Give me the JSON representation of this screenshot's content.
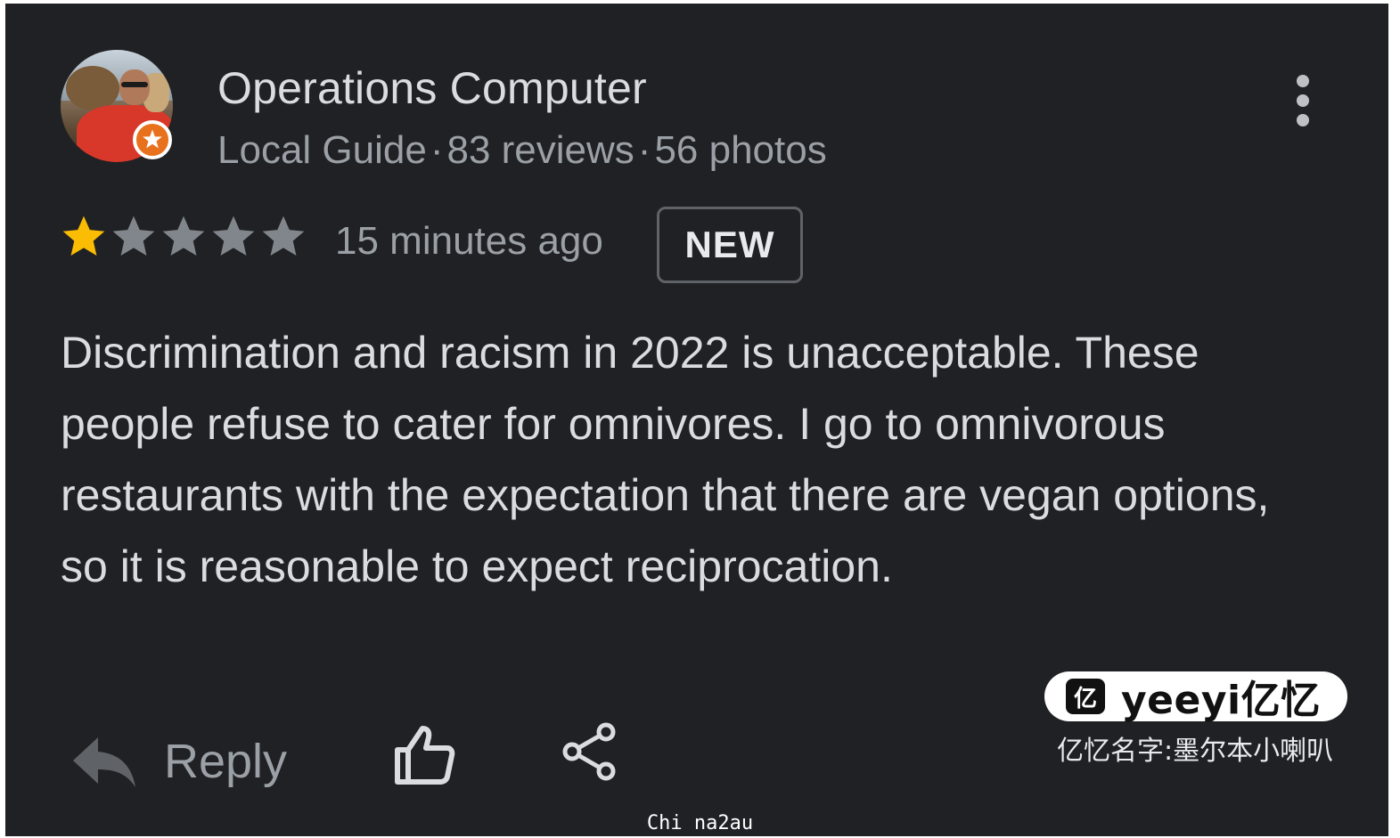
{
  "review": {
    "author": {
      "name": "Operations Computer",
      "role": "Local Guide",
      "separator": "·",
      "reviews": "83 reviews",
      "photos": "56 photos",
      "badge_icon": "local-guide-star-icon",
      "badge_color": "#e8711e"
    },
    "rating": {
      "value": 1,
      "max": 5,
      "filled_color": "#fbbc04",
      "empty_color": "#80868b"
    },
    "timestamp": "15 minutes ago",
    "badge": "NEW",
    "text": "Discrimination and racism in 2022 is unacceptable. These people refuse to cater for omnivores. I go to omnivorous restaurants with the expectation that there are vegan options, so it is reasonable to expect reciprocation.",
    "actions": {
      "reply_label": "Reply",
      "reply_icon": "reply-arrow-icon",
      "like_icon": "thumb-up-icon",
      "share_icon": "share-icon",
      "more_icon": "more-vertical-icon"
    }
  },
  "watermark": {
    "logo_mark": "亿",
    "logo_text": "yeeyi亿忆",
    "caption": "亿忆名字:墨尔本小喇叭"
  },
  "footer": {
    "credit": "Chi na2au"
  },
  "colors": {
    "background": "#202124",
    "primary_text": "#dadce0",
    "secondary_text": "#9aa0a6"
  }
}
